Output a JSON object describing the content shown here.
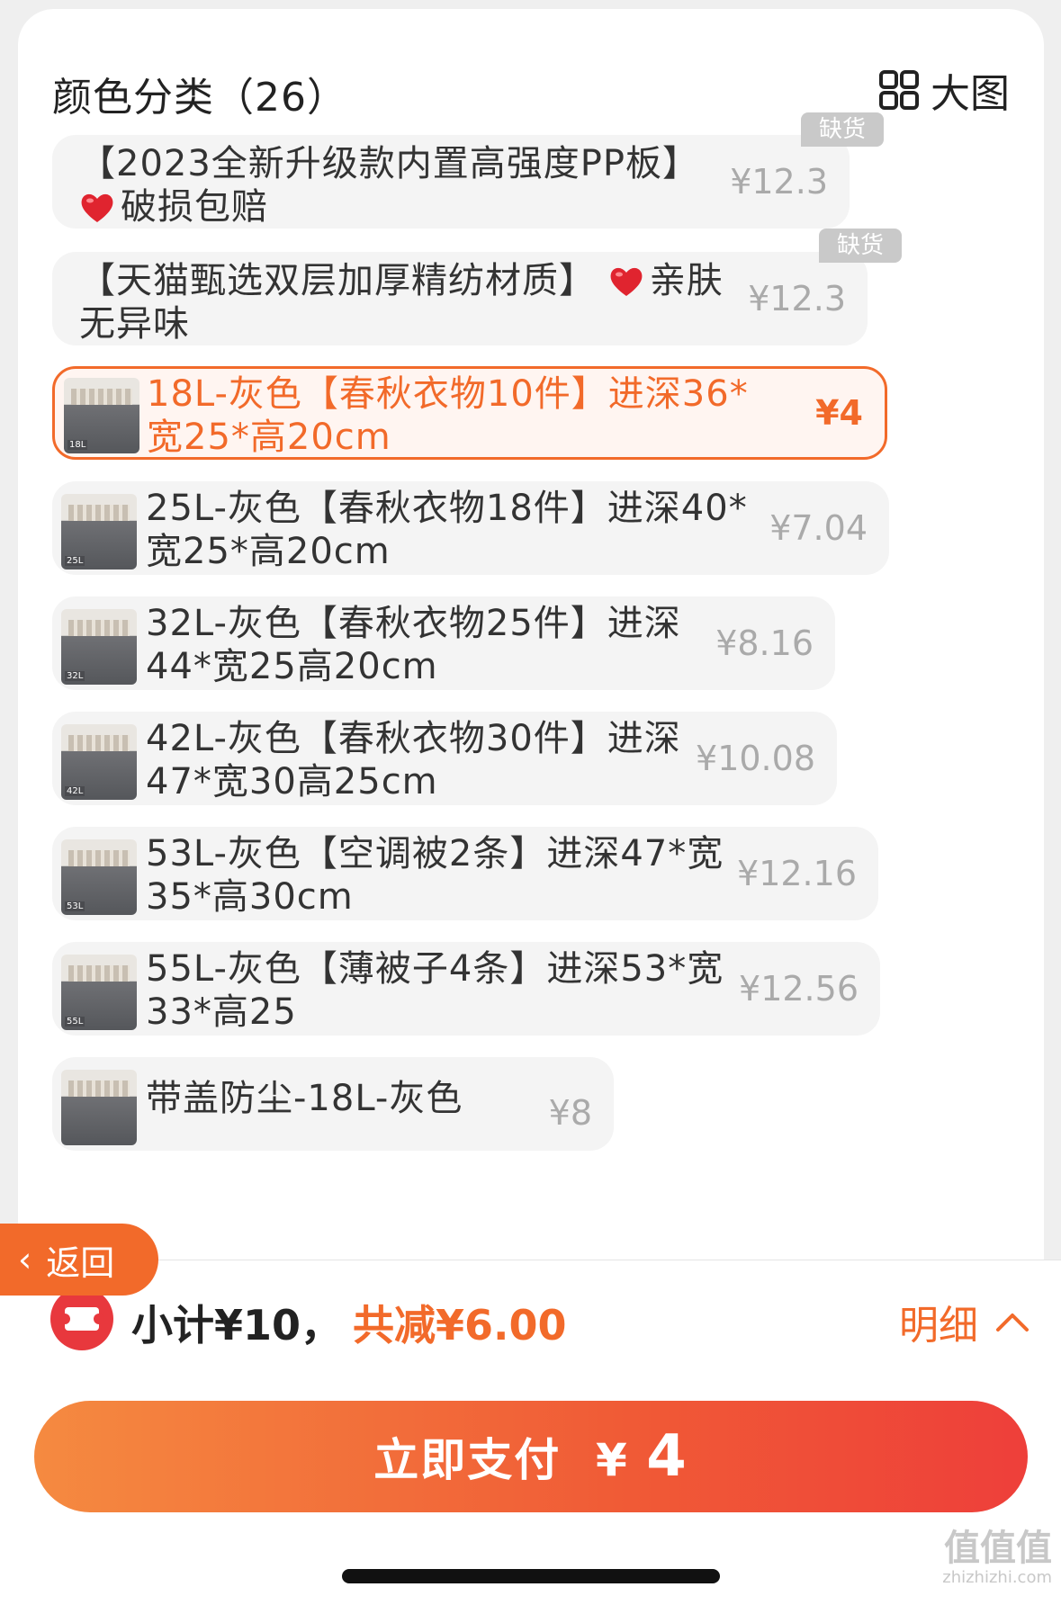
{
  "header": {
    "title": "颜色分类（26）",
    "big_image_label": "大图"
  },
  "options": [
    {
      "line1": "【2023全新升级款内置高强度PP板】",
      "line2": "破损包赔",
      "price": "¥12.3",
      "badge": "缺货"
    },
    {
      "line1": "【天猫甄选双层加厚精纺材质】",
      "line1_suffix": "亲肤",
      "line2": "无异味",
      "price": "¥12.3",
      "badge": "缺货"
    },
    {
      "line1": "18L-灰色【春秋衣物10件】进深36*",
      "line2": "宽25*高20cm",
      "price": "¥4",
      "thumb_tag": "18L",
      "selected": true
    },
    {
      "line1": "25L-灰色【春秋衣物18件】进深40*",
      "line2": "宽25*高20cm",
      "price": "¥7.04",
      "thumb_tag": "25L"
    },
    {
      "line1": "32L-灰色【春秋衣物25件】进深",
      "line2": "44*宽25高20cm",
      "price": "¥8.16",
      "thumb_tag": "32L"
    },
    {
      "line1": "42L-灰色【春秋衣物30件】进深",
      "line2": "47*宽30高25cm",
      "price": "¥10.08",
      "thumb_tag": "42L"
    },
    {
      "line1": "53L-灰色【空调被2条】进深47*宽",
      "line2": "35*高30cm",
      "price": "¥12.16",
      "thumb_tag": "53L"
    },
    {
      "line1": "55L-灰色【薄被子4条】进深53*宽",
      "line2": "33*高25",
      "price": "¥12.56",
      "thumb_tag": "55L"
    },
    {
      "line1": "带盖防尘-18L-灰色",
      "price": "¥8"
    }
  ],
  "back": {
    "label": "返回"
  },
  "footer": {
    "subtotal": "小计¥10，",
    "discount": "共减¥6.00",
    "detail_label": "明细",
    "pay_label": "立即支付",
    "pay_currency": "¥",
    "pay_amount": "4"
  },
  "watermark": {
    "text": "值值值",
    "site": "zhizhizhi.com"
  },
  "colors": {
    "accent": "#f26a2a",
    "coupon": "#e8383d",
    "badge": "#c9c9c9"
  }
}
